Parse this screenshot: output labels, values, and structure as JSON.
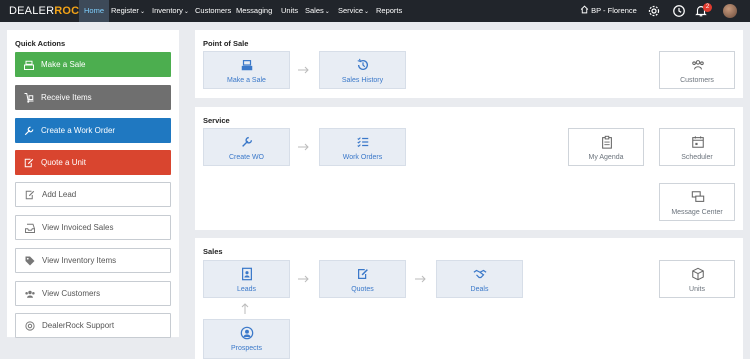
{
  "brand": {
    "part1": "DEALER",
    "part2": "ROCK"
  },
  "nav": {
    "items": [
      {
        "label": "Home",
        "caret": ""
      },
      {
        "label": "Register",
        "caret": "⌄"
      },
      {
        "label": "Inventory",
        "caret": "⌄"
      },
      {
        "label": "Customers",
        "caret": ""
      },
      {
        "label": "Messaging",
        "caret": ""
      },
      {
        "label": "Units",
        "caret": ""
      },
      {
        "label": "Sales",
        "caret": "⌄"
      },
      {
        "label": "Service",
        "caret": "⌄"
      },
      {
        "label": "Reports",
        "caret": ""
      }
    ],
    "location": "BP - Florence",
    "notification_count": "2"
  },
  "quick_actions": {
    "title": "Quick Actions",
    "buttons": [
      {
        "label": "Make a Sale",
        "color": "#4cae4f"
      },
      {
        "label": "Receive Items",
        "color": "#6f6f6f"
      },
      {
        "label": "Create a Work Order",
        "color": "#1f78c1"
      },
      {
        "label": "Quote a Unit",
        "color": "#d9452f"
      },
      {
        "label": "Add Lead"
      },
      {
        "label": "View Invoiced Sales"
      },
      {
        "label": "View Inventory Items"
      },
      {
        "label": "View Customers"
      },
      {
        "label": "DealerRock Support"
      }
    ]
  },
  "point_of_sale": {
    "title": "Point of Sale",
    "tiles": {
      "make_sale": "Make a Sale",
      "sales_history": "Sales History",
      "customers": "Customers"
    }
  },
  "service": {
    "title": "Service",
    "tiles": {
      "create_wo": "Create WO",
      "work_orders": "Work Orders",
      "my_agenda": "My Agenda",
      "scheduler": "Scheduler",
      "message_center": "Message Center"
    }
  },
  "sales": {
    "title": "Sales",
    "tiles": {
      "leads": "Leads",
      "quotes": "Quotes",
      "deals": "Deals",
      "units": "Units",
      "prospects": "Prospects"
    }
  }
}
